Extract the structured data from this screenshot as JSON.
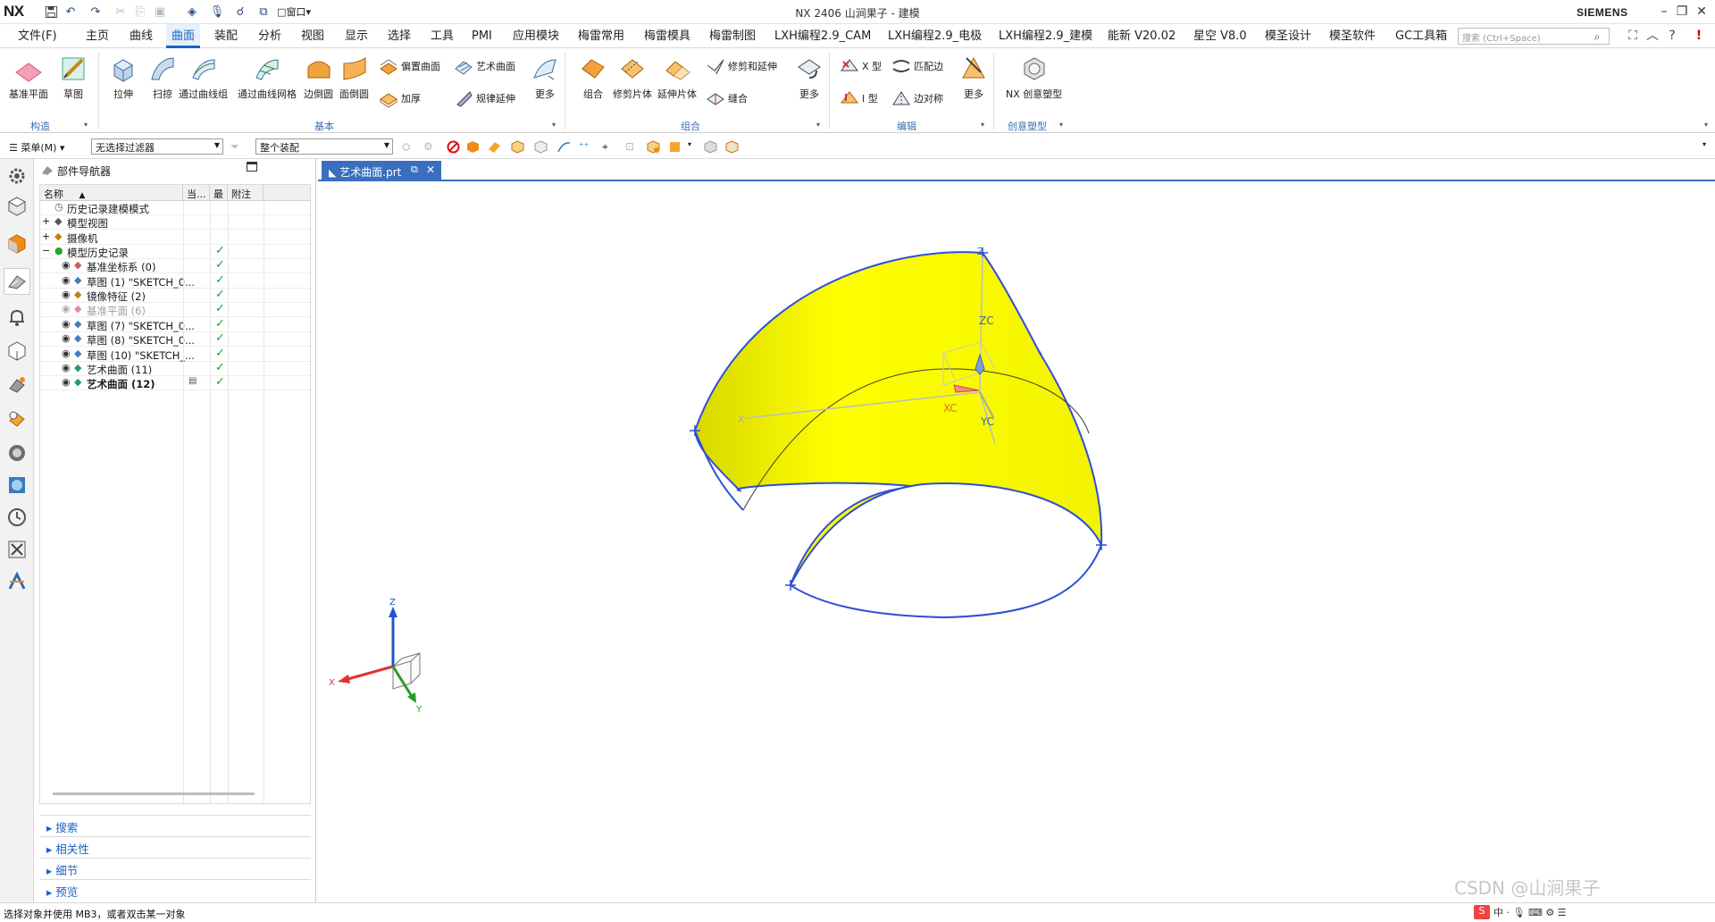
{
  "window": {
    "title": "NX 2406 山涧果子 - 建模",
    "logo": "NX",
    "brand": "SIEMENS",
    "window_menu": "窗口"
  },
  "menu": {
    "items": [
      "文件(F)",
      "主页",
      "曲线",
      "曲面",
      "装配",
      "分析",
      "视图",
      "显示",
      "选择",
      "工具",
      "PMI",
      "应用模块",
      "梅雷常用",
      "梅雷模具",
      "梅雷制图",
      "LXH编程2.9_CAM",
      "LXH编程2.9_电极",
      "LXH编程2.9_建模",
      "能新 V20.02",
      "星空 V8.0",
      "模圣设计",
      "模圣软件",
      "GC工具箱"
    ],
    "active": "曲面",
    "search_placeholder": "搜索 (Ctrl+Space)"
  },
  "ribbon": {
    "construct": {
      "group": "构造",
      "buttons": [
        "基准平面",
        "草图"
      ]
    },
    "basic": {
      "group": "基本",
      "buttons": [
        "拉伸",
        "扫掠",
        "通过曲线组",
        "通过曲线网格",
        "边倒圆",
        "面倒圆"
      ],
      "small": [
        "偏置曲面",
        "艺术曲面",
        "加厚",
        "规律延伸"
      ],
      "more": "更多"
    },
    "combine": {
      "group": "组合",
      "buttons": [
        "组合",
        "修剪片体",
        "延伸片体"
      ],
      "small": [
        "修剪和延伸",
        "缝合"
      ],
      "more": "更多"
    },
    "edit": {
      "group": "编辑",
      "small": [
        "X 型",
        "匹配边",
        "I 型",
        "边对称"
      ],
      "more": "更多"
    },
    "creative": {
      "group": "创意塑型",
      "button": "NX 创意塑型"
    }
  },
  "selection_bar": {
    "menu": "菜单(M)",
    "filter": "无选择过滤器",
    "scope": "整个装配"
  },
  "navigator": {
    "title": "部件导航器",
    "columns": [
      "名称",
      "当...",
      "最",
      "附注"
    ],
    "rows": [
      {
        "label": "历史记录建模模式",
        "check": false,
        "muted": false,
        "bold": false
      },
      {
        "label": "模型视图",
        "check": false,
        "muted": false,
        "bold": false
      },
      {
        "label": "摄像机",
        "check": false,
        "muted": false,
        "bold": false
      },
      {
        "label": "模型历史记录",
        "check": true,
        "muted": false,
        "bold": false
      },
      {
        "label": "基准坐标系 (0)",
        "check": true,
        "muted": false,
        "bold": false
      },
      {
        "label": "草图 (1) \"SKETCH_0...",
        "check": true,
        "muted": false,
        "bold": false
      },
      {
        "label": "镜像特征 (2)",
        "check": true,
        "muted": false,
        "bold": false
      },
      {
        "label": "基准平面 (6)",
        "check": true,
        "muted": true,
        "bold": false
      },
      {
        "label": "草图 (7) \"SKETCH_0...",
        "check": true,
        "muted": false,
        "bold": false
      },
      {
        "label": "草图 (8) \"SKETCH_0...",
        "check": true,
        "muted": false,
        "bold": false
      },
      {
        "label": "草图 (10) \"SKETCH_...",
        "check": true,
        "muted": false,
        "bold": false
      },
      {
        "label": "艺术曲面 (11)",
        "check": true,
        "muted": false,
        "bold": false
      },
      {
        "label": "艺术曲面 (12)",
        "check": true,
        "muted": false,
        "bold": true
      }
    ],
    "sections": [
      "搜索",
      "相关性",
      "细节",
      "预览"
    ]
  },
  "document_tab": "艺术曲面.prt",
  "axes": {
    "z": "Z",
    "zc": "ZC",
    "xc": "XC",
    "yc": "YC",
    "x": "X",
    "y": "Y"
  },
  "status": "选择对象并使用 MB3，或者双击某一对象",
  "watermark": "CSDN @山涧果子",
  "colors": {
    "accent": "#1763c6",
    "surface": "#f7f700",
    "edge": "#2f4fd6"
  }
}
